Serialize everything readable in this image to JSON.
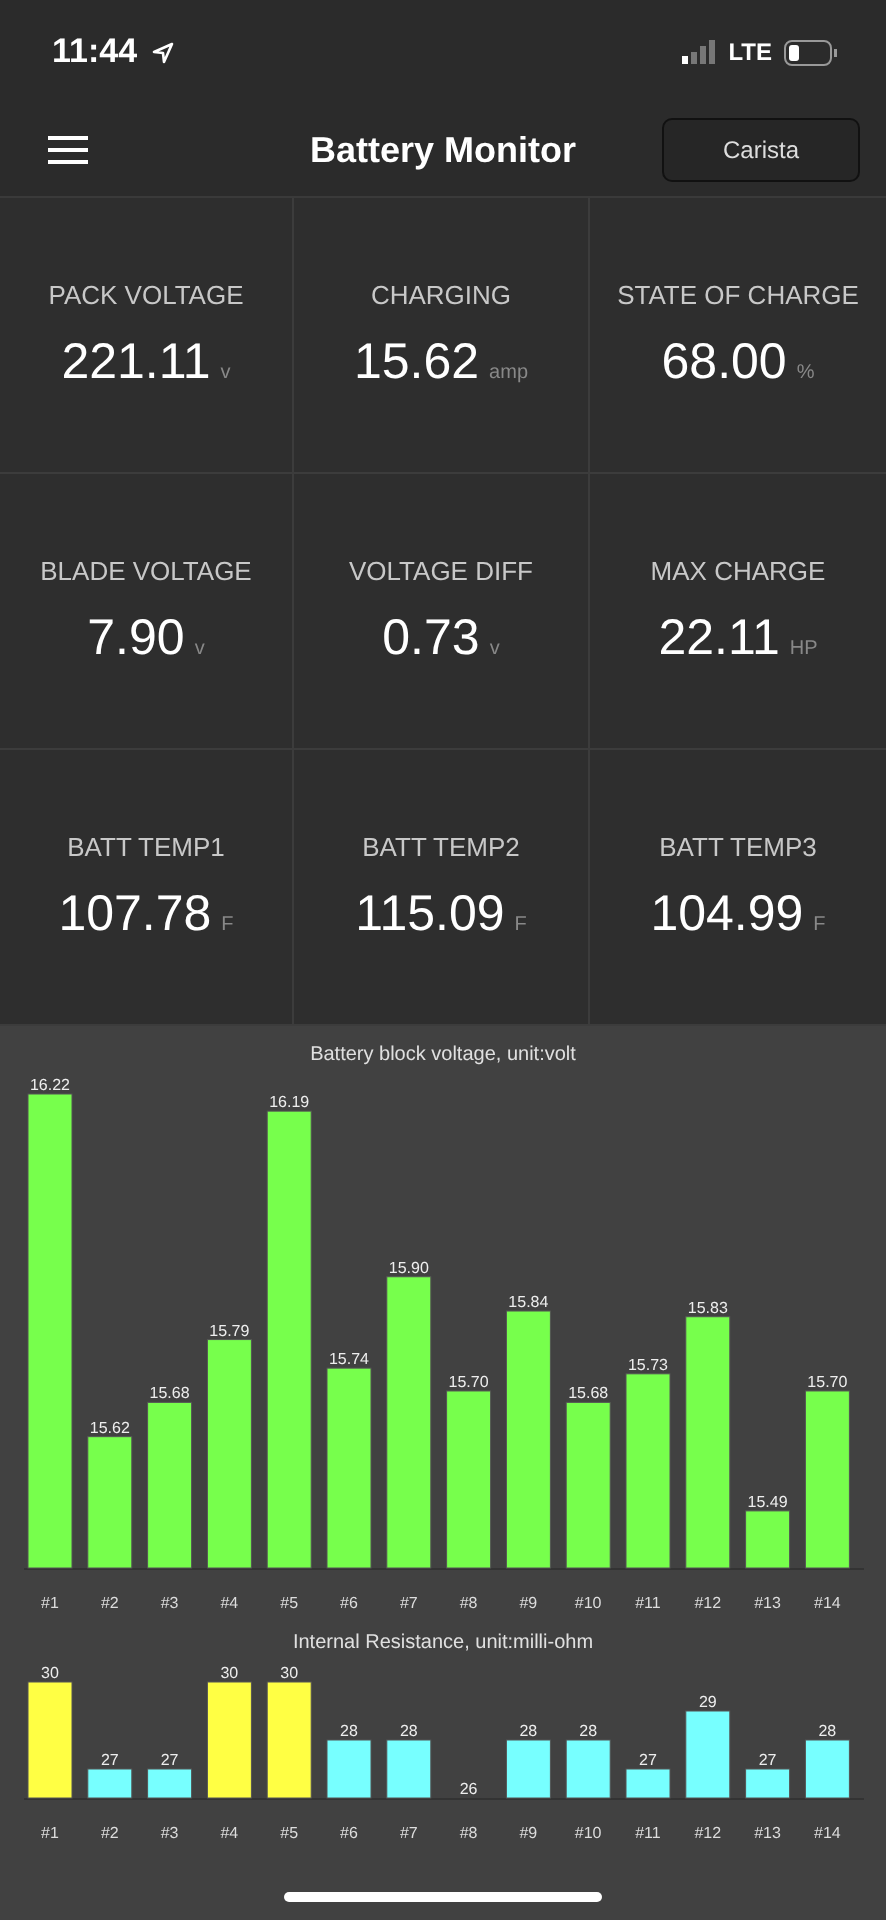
{
  "status_bar": {
    "time": "11:44",
    "network": "LTE"
  },
  "header": {
    "title": "Battery Monitor",
    "button": "Carista"
  },
  "metrics": [
    {
      "label": "PACK VOLTAGE",
      "value": "221.11",
      "unit": "v"
    },
    {
      "label": "CHARGING",
      "value": "15.62",
      "unit": "amp"
    },
    {
      "label": "STATE OF CHARGE",
      "value": "68.00",
      "unit": "%"
    },
    {
      "label": "BLADE VOLTAGE",
      "value": "7.90",
      "unit": "v"
    },
    {
      "label": "VOLTAGE DIFF",
      "value": "0.73",
      "unit": "v"
    },
    {
      "label": "MAX CHARGE",
      "value": "22.11",
      "unit": "HP"
    },
    {
      "label": "BATT TEMP1",
      "value": "107.78",
      "unit": "F"
    },
    {
      "label": "BATT TEMP2",
      "value": "115.09",
      "unit": "F"
    },
    {
      "label": "BATT TEMP3",
      "value": "104.99",
      "unit": "F"
    }
  ],
  "charts": [
    {
      "chart_data": {
        "type": "bar",
        "title": "Battery block voltage, unit:volt",
        "categories": [
          "#1",
          "#2",
          "#3",
          "#4",
          "#5",
          "#6",
          "#7",
          "#8",
          "#9",
          "#10",
          "#11",
          "#12",
          "#13",
          "#14"
        ],
        "ylim": [
          15.39,
          16.22
        ],
        "data_labels": true,
        "series": [
          {
            "color": "#77ff4c",
            "values": [
              16.22,
              15.62,
              15.68,
              15.79,
              16.19,
              15.74,
              15.9,
              15.7,
              15.84,
              15.68,
              15.73,
              15.83,
              15.49,
              15.7
            ],
            "value_labels": [
              "16.22",
              "15.62",
              "15.68",
              "15.79",
              "16.19",
              "15.74",
              "15.90",
              "15.70",
              "15.84",
              "15.68",
              "15.73",
              "15.83",
              "15.49",
              "15.70"
            ]
          }
        ]
      }
    },
    {
      "chart_data": {
        "type": "bar",
        "title": "Internal Resistance, unit:milli-ohm",
        "categories": [
          "#1",
          "#2",
          "#3",
          "#4",
          "#5",
          "#6",
          "#7",
          "#8",
          "#9",
          "#10",
          "#11",
          "#12",
          "#13",
          "#14"
        ],
        "ylim": [
          26,
          30
        ],
        "data_labels": true,
        "series": [
          {
            "color": "#ffff44",
            "values": [
              30,
              null,
              null,
              30,
              30,
              null,
              null,
              null,
              null,
              null,
              null,
              null,
              null,
              null
            ],
            "value_labels": [
              "30",
              null,
              null,
              "30",
              "30",
              null,
              null,
              null,
              null,
              null,
              null,
              null,
              null,
              null
            ]
          },
          {
            "color": "#77ffff",
            "values": [
              null,
              27,
              27,
              null,
              null,
              28,
              28,
              26,
              28,
              28,
              27,
              29,
              27,
              28
            ],
            "value_labels": [
              null,
              "27",
              "27",
              null,
              null,
              "28",
              "28",
              "26",
              "28",
              "28",
              "27",
              "29",
              "27",
              "28"
            ]
          }
        ]
      }
    }
  ]
}
